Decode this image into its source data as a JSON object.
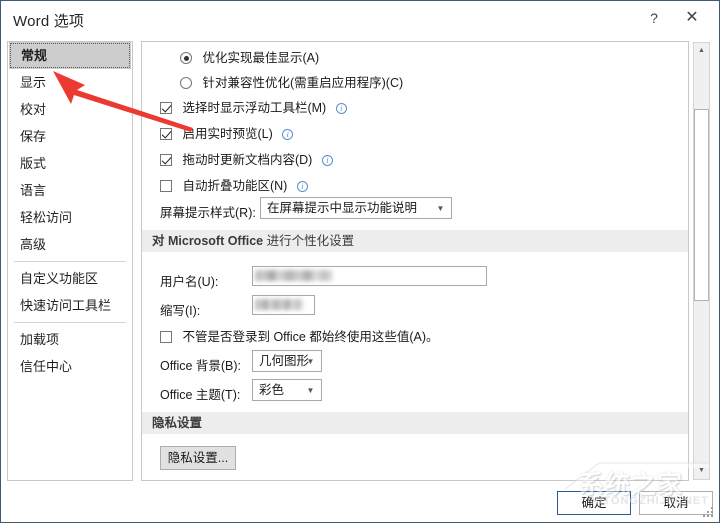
{
  "window": {
    "title": "Word 选项",
    "help_icon": "?",
    "close_icon": "✕"
  },
  "sidebar": {
    "items": [
      {
        "label": "常规",
        "selected": true
      },
      {
        "label": "显示",
        "selected": false
      },
      {
        "label": "校对",
        "selected": false
      },
      {
        "label": "保存",
        "selected": false
      },
      {
        "label": "版式",
        "selected": false
      },
      {
        "label": "语言",
        "selected": false
      },
      {
        "label": "轻松访问",
        "selected": false
      },
      {
        "label": "高级",
        "selected": false
      },
      {
        "label": "自定义功能区",
        "selected": false
      },
      {
        "label": "快速访问工具栏",
        "selected": false
      },
      {
        "label": "加载项",
        "selected": false
      },
      {
        "label": "信任中心",
        "selected": false
      }
    ]
  },
  "content": {
    "radio_optimize_display": {
      "label": "优化实现最佳显示(A)",
      "mnemonic": "A",
      "checked": true
    },
    "radio_optimize_compat": {
      "label": "针对兼容性优化(需重启应用程序)(C)",
      "mnemonic": "C",
      "checked": false
    },
    "check_mini_toolbar": {
      "label": "选择时显示浮动工具栏(M)",
      "mnemonic": "M",
      "checked": true,
      "info": "ⓘ"
    },
    "check_live_preview": {
      "label": "启用实时预览(L)",
      "mnemonic": "L",
      "checked": true,
      "info": "ⓘ"
    },
    "check_update_on_drag": {
      "label": "拖动时更新文档内容(D)",
      "mnemonic": "D",
      "checked": true,
      "info": "ⓘ"
    },
    "check_collapse_ribbon": {
      "label": "自动折叠功能区(N)",
      "mnemonic": "N",
      "checked": false,
      "info": "ⓘ"
    },
    "screentip": {
      "label": "屏幕提示样式(R):",
      "value": "在屏幕提示中显示功能说明",
      "caret": "▼"
    },
    "section_personalize": {
      "prefix": "对 ",
      "brand": "Microsoft Office",
      "suffix": " 进行个性化设置"
    },
    "username": {
      "label": "用户名(U):",
      "value": ""
    },
    "initials": {
      "label": "缩写(I):",
      "value": ""
    },
    "check_always_use": {
      "label": "不管是否登录到 Office 都始终使用这些值(A)。",
      "mnemonic": "A",
      "checked": false
    },
    "office_background": {
      "label": "Office 背景(B):",
      "value": "几何图形",
      "caret": "▼"
    },
    "office_theme": {
      "label": "Office 主题(T):",
      "value": "彩色",
      "caret": "▼"
    },
    "section_privacy": {
      "title": "隐私设置"
    },
    "privacy_button": {
      "label": "隐私设置..."
    }
  },
  "scrollbar": {
    "up_arrow": "▲",
    "down_arrow": "▼"
  },
  "footer": {
    "ok_label": "确定",
    "cancel_label": "取消"
  },
  "watermark": {
    "main": "系统之家",
    "sub": "XITONGZHIJIA.NET"
  },
  "colors": {
    "dialog_border": "#3a5a78",
    "selection_bg": "#cdcdcd",
    "section_bg": "#ededed",
    "accent_button_border": "#2b5797",
    "annotation_red": "#ec3a32",
    "info_icon_blue": "#5b8fc9"
  }
}
